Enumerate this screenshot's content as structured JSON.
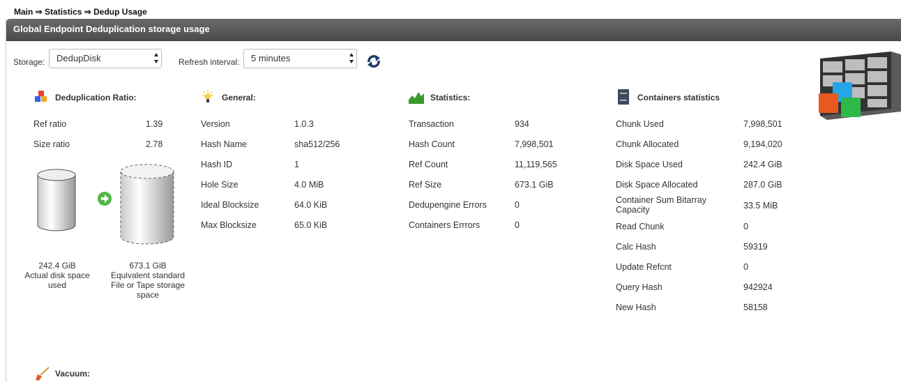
{
  "breadcrumb": "Main ⇒ Statistics ⇒ Dedup Usage",
  "panel_title": "Global Endpoint Deduplication storage usage",
  "storage": {
    "label": "Storage:",
    "value": "DedupDisk"
  },
  "refresh": {
    "label": "Refresh interval:",
    "value": "5 minutes"
  },
  "dedup": {
    "title": "Deduplication Ratio:",
    "rows": [
      {
        "label": "Ref ratio",
        "value": "1.39"
      },
      {
        "label": "Size ratio",
        "value": "2.78"
      }
    ],
    "actual": {
      "size": "242.4 GiB",
      "caption": "Actual disk space used"
    },
    "equivalent": {
      "size": "673.1 GiB",
      "caption": "Equivalent standard File or Tape storage space"
    }
  },
  "general": {
    "title": "General:",
    "rows": [
      {
        "label": "Version",
        "value": "1.0.3"
      },
      {
        "label": "Hash Name",
        "value": "sha512/256"
      },
      {
        "label": "Hash ID",
        "value": "1"
      },
      {
        "label": "Hole Size",
        "value": "4.0 MiB"
      },
      {
        "label": "Ideal Blocksize",
        "value": "64.0 KiB"
      },
      {
        "label": "Max Blocksize",
        "value": "65.0 KiB"
      }
    ]
  },
  "statistics": {
    "title": "Statistics:",
    "rows": [
      {
        "label": "Transaction",
        "value": "934"
      },
      {
        "label": "Hash Count",
        "value": "7,998,501"
      },
      {
        "label": "Ref Count",
        "value": "11,119,565"
      },
      {
        "label": "Ref Size",
        "value": "673.1 GiB"
      },
      {
        "label": "Dedupengine Errors",
        "value": "0"
      },
      {
        "label": "Containers Errrors",
        "value": "0"
      }
    ]
  },
  "containers": {
    "title": "Containers statistics",
    "rows": [
      {
        "label": "Chunk Used",
        "value": "7,998,501"
      },
      {
        "label": "Chunk Allocated",
        "value": "9,194,020"
      },
      {
        "label": "Disk Space Used",
        "value": "242.4 GiB"
      },
      {
        "label": "Disk Space Allocated",
        "value": "287.0 GiB"
      },
      {
        "label": "Container Sum Bitarray Capacity",
        "value": "33.5 MiB"
      },
      {
        "label": "Read Chunk",
        "value": "0"
      },
      {
        "label": "Calc Hash",
        "value": "59319"
      },
      {
        "label": "Update Refcnt",
        "value": "0"
      },
      {
        "label": "Query Hash",
        "value": "942924"
      },
      {
        "label": "New Hash",
        "value": "58158"
      }
    ]
  },
  "vacuum": {
    "title": "Vacuum:"
  }
}
